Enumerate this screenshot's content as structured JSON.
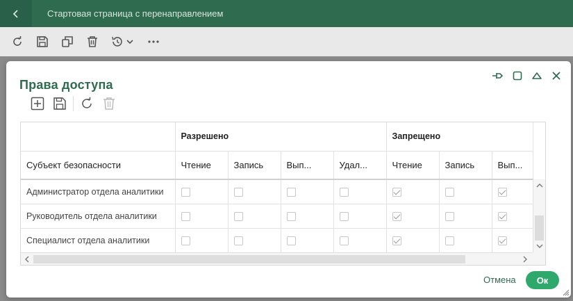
{
  "app": {
    "title": "Стартовая страница с перенаправлением"
  },
  "app_toolbar": {
    "icons": [
      "refresh-icon",
      "save-icon",
      "copy-icon",
      "delete-icon",
      "history-icon",
      "more-icon"
    ]
  },
  "dialog": {
    "title": "Права доступа",
    "toolbar_icons": [
      "add-icon",
      "save-icon",
      "refresh-icon",
      "delete-icon"
    ],
    "controls": [
      "pin-icon",
      "maximize-icon",
      "collapse-icon",
      "close-icon"
    ]
  },
  "table": {
    "groups": {
      "allowed": "Разрешено",
      "denied": "Запрещено"
    },
    "subject_header": "Субъект безопасности",
    "columns": [
      "Чтение",
      "Запись",
      "Вып...",
      "Удал...",
      "Чтение",
      "Запись",
      "Вып..."
    ],
    "rows": [
      {
        "subject": "Администратор отдела аналитики",
        "checks": [
          false,
          false,
          false,
          false,
          true,
          false,
          true
        ]
      },
      {
        "subject": "Руководитель отдела аналитики",
        "checks": [
          false,
          false,
          false,
          false,
          true,
          false,
          true
        ]
      },
      {
        "subject": "Специалист отдела аналитики",
        "checks": [
          false,
          false,
          false,
          false,
          true,
          false,
          true
        ]
      }
    ]
  },
  "footer": {
    "cancel_label": "Отмена",
    "ok_label": "Ок"
  },
  "colors": {
    "header_bg": "#2e6b4f",
    "accent": "#2fa96b",
    "title": "#2e6b4f"
  }
}
